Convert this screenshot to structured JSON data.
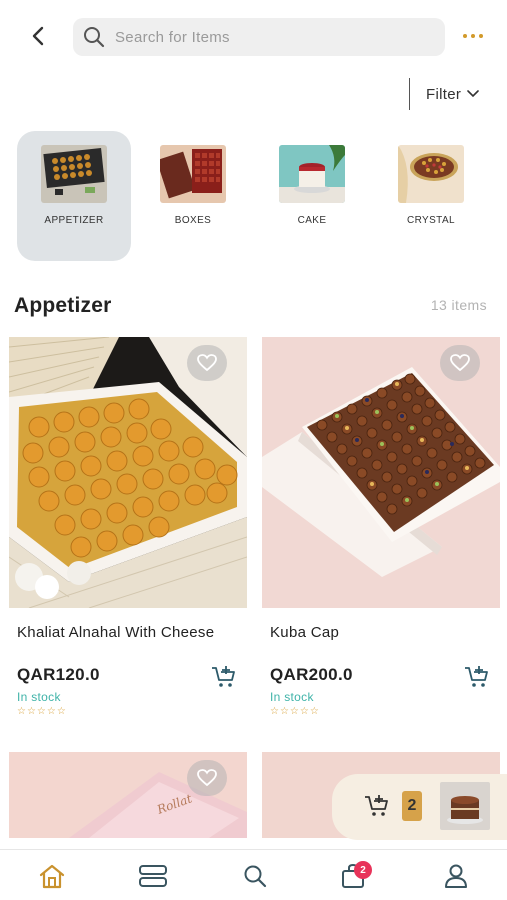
{
  "search": {
    "placeholder": "Search for Items"
  },
  "filter": {
    "label": "Filter"
  },
  "categories": [
    {
      "label": "APPETIZER",
      "active": true
    },
    {
      "label": "BOXES",
      "active": false
    },
    {
      "label": "CAKE",
      "active": false
    },
    {
      "label": "CRYSTAL",
      "active": false
    }
  ],
  "section": {
    "title": "Appetizer",
    "count": "13 items"
  },
  "products": [
    {
      "name": "Khaliat Alnahal With Cheese",
      "price": "QAR120.0",
      "stock": "In stock",
      "stars": "☆☆☆☆☆"
    },
    {
      "name": "Kuba Cap",
      "price": "QAR200.0",
      "stock": "In stock",
      "stars": "☆☆☆☆☆"
    }
  ],
  "floating_cart": {
    "count": "2"
  },
  "bottom_nav": {
    "cart_badge": "2"
  },
  "colors": {
    "accent": "#d29a2a",
    "stock": "#3fb3a8",
    "badge": "#e8335a",
    "card_bg": "#f3d9d2"
  },
  "icons": [
    "back-icon",
    "search-icon",
    "more-icon",
    "chevron-down-icon",
    "heart-icon",
    "add-to-cart-icon",
    "home-icon",
    "categories-icon",
    "cart-icon",
    "profile-icon"
  ]
}
